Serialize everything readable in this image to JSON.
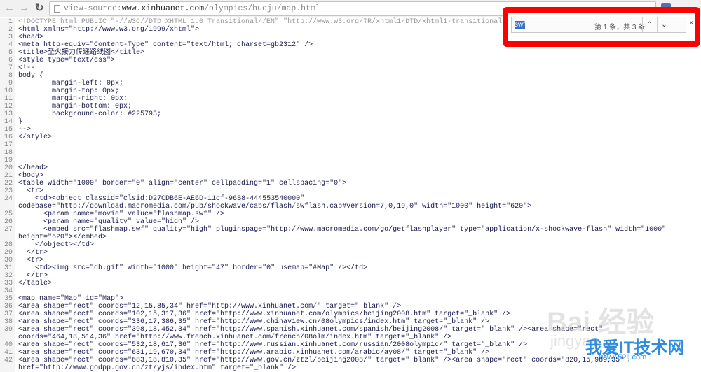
{
  "browser": {
    "url_scheme": "view-source:",
    "url_host": "www.xinhuanet.com",
    "url_path": "/olympics/huoju/map.html"
  },
  "find": {
    "query": "swf",
    "count": "第 1 条，共 3 条",
    "prev": "⌃",
    "next": "⌄",
    "close": "×"
  },
  "watermark": {
    "baidu": "Bai  经验",
    "baidu_sub": "jingyan",
    "site": "我爱IT技术网",
    "site_url": "www.52ij.com"
  },
  "lines": [
    {
      "n": "1",
      "text": "<!DOCTYPE html PUBLIC \"-//W3C//DTD XHTML 1.0 Transitional//EN\" \"http://www.w3.org/TR/xhtml1/DTD/xhtml1-transitional.dtd\">"
    },
    {
      "n": "2",
      "text": "<html xmlns=\"http://www.w3.org/1999/xhtml\">"
    },
    {
      "n": "3",
      "text": "<head>"
    },
    {
      "n": "4",
      "text": "<meta http-equiv=\"Content-Type\" content=\"text/html; charset=gb2312\" />"
    },
    {
      "n": "5",
      "text": "<title>圣火接力传递路线图</title>"
    },
    {
      "n": "6",
      "text": "<style type=\"text/css\">"
    },
    {
      "n": "7",
      "text": "<!--"
    },
    {
      "n": "8",
      "text": "body {"
    },
    {
      "n": "9",
      "text": "\tmargin-left: 0px;"
    },
    {
      "n": "10",
      "text": "\tmargin-top: 0px;"
    },
    {
      "n": "11",
      "text": "\tmargin-right: 0px;"
    },
    {
      "n": "12",
      "text": "\tmargin-bottom: 0px;"
    },
    {
      "n": "13",
      "text": "\tbackground-color: #225793;"
    },
    {
      "n": "14",
      "text": "}"
    },
    {
      "n": "15",
      "text": "-->"
    },
    {
      "n": "16",
      "text": "</style>"
    },
    {
      "n": "17",
      "text": ""
    },
    {
      "n": "18",
      "text": ""
    },
    {
      "n": "19",
      "text": ""
    },
    {
      "n": "20",
      "text": "</head>"
    },
    {
      "n": "21",
      "text": "<body>"
    },
    {
      "n": "22",
      "text": "<table width=\"1000\" border=\"0\" align=\"center\" cellpadding=\"1\" cellspacing=\"0\">"
    },
    {
      "n": "23",
      "text": "  <tr>"
    },
    {
      "n": "24",
      "text": "    <td><object classid=\"clsid:D27CDB6E-AE6D-11cf-96B8-444553540000\" codebase=\"http://download.macromedia.com/pub/shockwave/cabs/flash/swflash.cab#version=7,0,19,0\" width=\"1000\" height=\"620\">"
    },
    {
      "n": "25",
      "text": "      <param name=\"movie\" value=\"flashmap.swf\" />"
    },
    {
      "n": "26",
      "text": "      <param name=\"quality\" value=\"high\" />"
    },
    {
      "n": "27",
      "text": "      <embed src=\"flashmap.swf\" quality=\"high\" pluginspage=\"http://www.macromedia.com/go/getflashplayer\" type=\"application/x-shockwave-flash\" width=\"1000\" height=\"620\"></embed>"
    },
    {
      "n": "28",
      "text": "    </object></td>"
    },
    {
      "n": "29",
      "text": "  </tr>"
    },
    {
      "n": "30",
      "text": "  <tr>"
    },
    {
      "n": "31",
      "text": "    <td><img src=\"dh.gif\" width=\"1000\" height=\"47\" border=\"0\" usemap=\"#Map\" /></td>"
    },
    {
      "n": "32",
      "text": "  </tr>"
    },
    {
      "n": "33",
      "text": "</table>"
    },
    {
      "n": "34",
      "text": ""
    },
    {
      "n": "35",
      "text": "<map name=\"Map\" id=\"Map\">"
    },
    {
      "n": "36",
      "text": "<area shape=\"rect\" coords=\"12,15,85,34\" href=\"http://www.xinhuanet.com/\" target=\"_blank\" />"
    },
    {
      "n": "37",
      "text": "<area shape=\"rect\" coords=\"102,15,317,36\" href=\"http://www.xinhuanet.com/olympics/beijing2008.htm\" target=\"_blank\" />"
    },
    {
      "n": "38",
      "text": "<area shape=\"rect\" coords=\"336,17,386,35\" href=\"http://www.chinaview.cn/08olympics/index.htm\" target=\"_blank\" />"
    },
    {
      "n": "39",
      "text": "<area shape=\"rect\" coords=\"398,18,452,34\" href=\"http://www.spanish.xinhuanet.com/spanish/beijing2008/\" target=\"_blank\" /><area shape=\"rect\" coords=\"464,18,514,36\" href=\"http://www.french.xinhuanet.com/french/08olm/index.htm\" target=\"_blank\" />"
    },
    {
      "n": "40",
      "text": "<area shape=\"rect\" coords=\"532,18,617,36\" href=\"http://www.russian.xinhuanet.com/russian/2008olympic/\" target=\"_blank\" />"
    },
    {
      "n": "41",
      "text": "<area shape=\"rect\" coords=\"631,19,670,34\" href=\"http://www.arabic.xinhuanet.com/arabic/ay08/\" target=\"_blank\" />"
    },
    {
      "n": "42",
      "text": "<area shape=\"rect\" coords=\"683,18,810,35\" href=\"http://www.gov.cn/ztzl/beijing2008/\" target=\"_blank\" /><area shape=\"rect\" coords=\"820,15,989,35\" href=\"http://www.godpp.gov.cn/zt/yjs/index.htm\" target=\"_blank\" />"
    }
  ]
}
